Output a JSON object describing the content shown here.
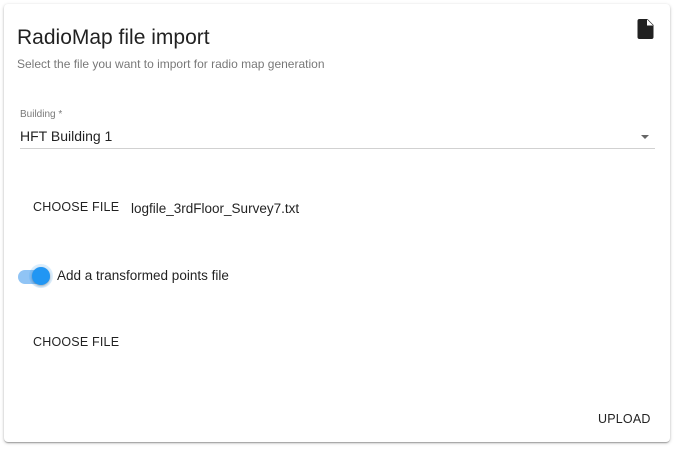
{
  "dialog": {
    "title": "RadioMap file import",
    "subtitle": "Select the file you want to import for radio map generation",
    "header_icon": "file-icon"
  },
  "building_select": {
    "label": "Building *",
    "value": "HFT Building 1",
    "icon": "dropdown-arrow-icon"
  },
  "log_file": {
    "button_label": "CHOOSE FILE",
    "selected_file": "logfile_3rdFloor_Survey7.txt"
  },
  "transformed_points": {
    "toggle_label": "Add a transformed points file",
    "enabled": true,
    "button_label": "CHOOSE FILE"
  },
  "actions": {
    "upload_label": "UPLOAD"
  },
  "colors": {
    "accent": "#2196f3",
    "track": "#90c4f5"
  }
}
